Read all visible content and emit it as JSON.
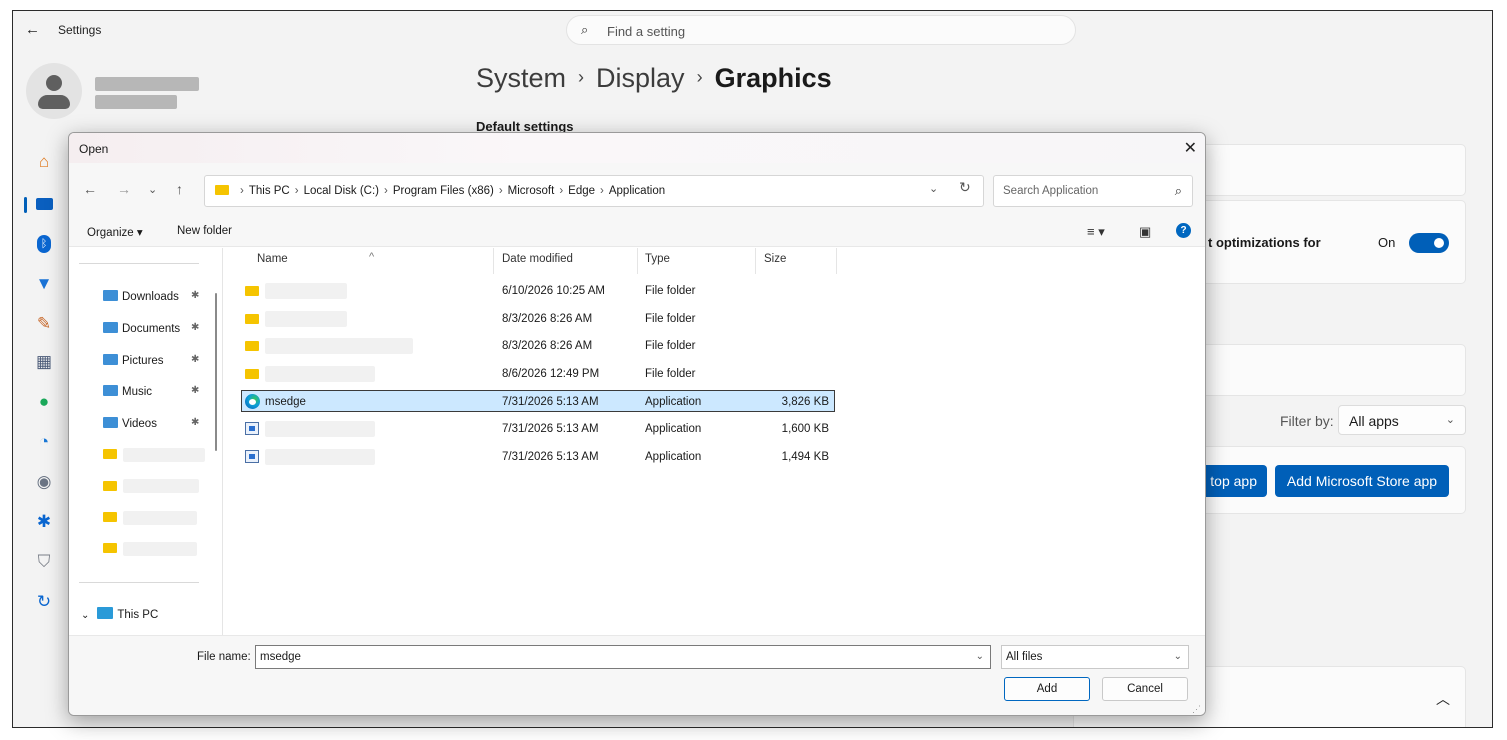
{
  "settings": {
    "app_title": "Settings",
    "search_placeholder": "Find a setting",
    "breadcrumb": {
      "part1": "System",
      "part2": "Display",
      "current": "Graphics"
    },
    "section_label": "Default settings",
    "optimizations_text": "t optimizations for",
    "toggle_label": "On",
    "filter_label": "Filter by:",
    "filter_value": "All apps",
    "add_desktop_app_label": "top app",
    "add_store_app_label": "Add Microsoft Store app",
    "nav_icons": [
      "home-icon",
      "system-icon",
      "bluetooth-icon",
      "network-icon",
      "personalization-icon",
      "apps-icon",
      "accounts-icon",
      "time-language-icon",
      "gaming-icon",
      "accessibility-icon",
      "privacy-security-icon",
      "windows-update-icon"
    ]
  },
  "dialog": {
    "title": "Open",
    "address_path": [
      "This PC",
      "Local Disk (C:)",
      "Program Files (x86)",
      "Microsoft",
      "Edge",
      "Application"
    ],
    "search_placeholder": "Search Application",
    "organize_label": "Organize ▾",
    "new_folder_label": "New folder",
    "columns": {
      "name": "Name",
      "date": "Date modified",
      "type": "Type",
      "size": "Size"
    },
    "quick_access": [
      {
        "label": "Downloads"
      },
      {
        "label": "Documents"
      },
      {
        "label": "Pictures"
      },
      {
        "label": "Music"
      },
      {
        "label": "Videos"
      }
    ],
    "this_pc_label": "This PC",
    "files": [
      {
        "name": "",
        "date": "6/10/2026 10:25 AM",
        "type": "File folder",
        "size": ""
      },
      {
        "name": "",
        "date": "8/3/2026 8:26 AM",
        "type": "File folder",
        "size": ""
      },
      {
        "name": "",
        "date": "8/3/2026 8:26 AM",
        "type": "File folder",
        "size": ""
      },
      {
        "name": "",
        "date": "8/6/2026 12:49 PM",
        "type": "File folder",
        "size": ""
      },
      {
        "name": "msedge",
        "date": "7/31/2026 5:13 AM",
        "type": "Application",
        "size": "3,826 KB"
      },
      {
        "name": "",
        "date": "7/31/2026 5:13 AM",
        "type": "Application",
        "size": "1,600 KB"
      },
      {
        "name": "",
        "date": "7/31/2026 5:13 AM",
        "type": "Application",
        "size": "1,494 KB"
      }
    ],
    "file_name_label": "File name:",
    "file_name_value": "msedge",
    "file_type_value": "All files",
    "add_button_label": "Add",
    "cancel_button_label": "Cancel"
  },
  "colors": {
    "accent": "#005fb8",
    "selection": "#cce8ff",
    "folder": "#f5c400"
  }
}
